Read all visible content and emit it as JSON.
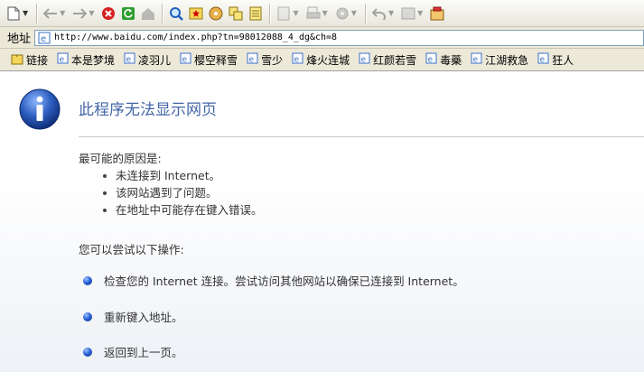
{
  "address_bar": {
    "label": "地址",
    "url": "http://www.baidu.com/index.php?tn=98012088_4_dg&ch=8"
  },
  "links_bar": {
    "items": [
      "链接",
      "本是梦境",
      "凌羽儿",
      "樱空释雪",
      "雪少",
      "烽火连城",
      "红颜若雪",
      "毒藥",
      "江湖救急",
      "狂人"
    ]
  },
  "error_page": {
    "title": "此程序无法显示网页",
    "causes_heading": "最可能的原因是:",
    "causes": [
      "未连接到 Internet。",
      "该网站遇到了问题。",
      "在地址中可能存在键入错误。"
    ],
    "actions_heading": "您可以尝试以下操作:",
    "actions": [
      "检查您的 Internet 连接。尝试访问其他网站以确保已连接到 Internet。",
      "重新键入地址。",
      "返回到上一页。"
    ]
  },
  "colors": {
    "title": "#4466a8",
    "info_icon": "#2d5fbf",
    "stop": "#d42020",
    "refresh": "#2f9e2f"
  }
}
